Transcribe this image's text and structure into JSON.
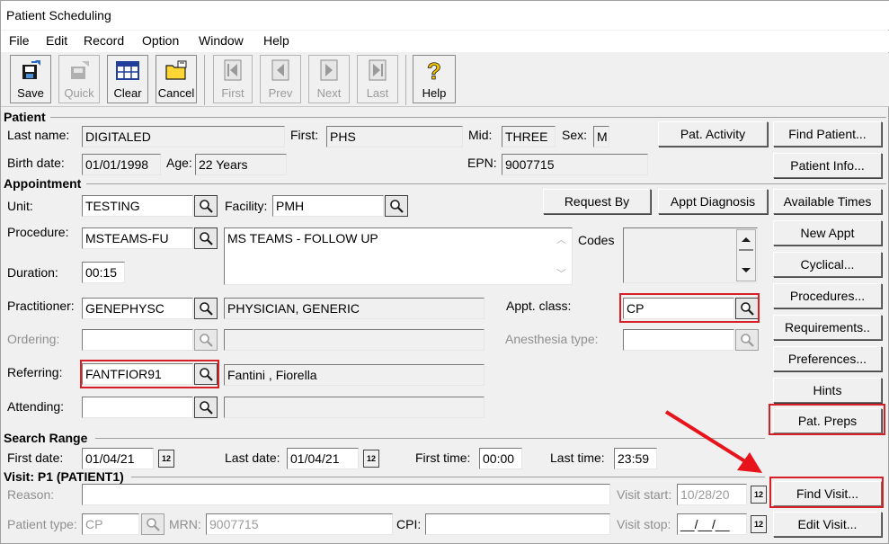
{
  "window": {
    "title": "Patient Scheduling"
  },
  "menu": [
    "File",
    "Edit",
    "Record",
    "Option",
    "Window",
    "Help"
  ],
  "toolbar": {
    "save": "Save",
    "quick": "Quick",
    "clear": "Clear",
    "cancel": "Cancel",
    "first": "First",
    "prev": "Prev",
    "next": "Next",
    "last": "Last",
    "help": "Help"
  },
  "patient": {
    "section": "Patient",
    "last_name_label": "Last name:",
    "last_name": "DIGITALED",
    "first_label": "First:",
    "first": "PHS",
    "mid_label": "Mid:",
    "mid": "THREE",
    "sex_label": "Sex:",
    "sex": "M",
    "birth_label": "Birth date:",
    "birth_date": "01/01/1998",
    "age_label": "Age:",
    "age": "22 Years",
    "epn_label": "EPN:",
    "epn": "9007715",
    "pat_activity": "Pat. Activity",
    "find_patient": "Find Patient...",
    "patient_info": "Patient Info..."
  },
  "appointment": {
    "section": "Appointment",
    "unit_label": "Unit:",
    "unit": "TESTING",
    "facility_label": "Facility:",
    "facility": "PMH",
    "request_by": "Request By",
    "appt_diagnosis": "Appt Diagnosis",
    "procedure_label": "Procedure:",
    "procedure": "MSTEAMS-FU",
    "procedure_desc": "MS TEAMS - FOLLOW UP",
    "codes_label": "Codes",
    "duration_label": "Duration:",
    "duration": "00:15",
    "practitioner_label": "Practitioner:",
    "practitioner": "GENEPHYSC",
    "practitioner_name": "PHYSICIAN, GENERIC",
    "appt_class_label": "Appt. class:",
    "appt_class": "CP",
    "ordering_label": "Ordering:",
    "ordering": "",
    "anesthesia_label": "Anesthesia type:",
    "anesthesia": "",
    "referring_label": "Referring:",
    "referring": "FANTFIOR91",
    "referring_name": "Fantini , Fiorella",
    "attending_label": "Attending:",
    "attending": ""
  },
  "side_buttons": {
    "available_times": "Available Times",
    "new_appt": "New Appt",
    "cyclical": "Cyclical...",
    "procedures": "Procedures...",
    "requirements": "Requirements..",
    "preferences": "Preferences...",
    "hints": "Hints",
    "pat_preps": "Pat. Preps"
  },
  "search_range": {
    "section": "Search Range",
    "first_date_label": "First date:",
    "first_date": "01/04/21",
    "last_date_label": "Last date:",
    "last_date": "01/04/21",
    "first_time_label": "First time:",
    "first_time": "00:00",
    "last_time_label": "Last time:",
    "last_time": "23:59"
  },
  "visit": {
    "section": "Visit: P1 (PATIENT1)",
    "reason_label": "Reason:",
    "reason": "",
    "visit_start_label": "Visit start:",
    "visit_start": "10/28/20",
    "patient_type_label": "Patient type:",
    "patient_type": "CP",
    "mrn_label": "MRN:",
    "mrn": "9007715",
    "cpi_label": "CPI:",
    "cpi": "",
    "visit_stop_label": "Visit stop:",
    "visit_stop": "__/__/__",
    "find_visit": "Find Visit...",
    "edit_visit": "Edit Visit..."
  },
  "colors": {
    "highlight": "#d61f26",
    "arrow": "#e8141c"
  }
}
